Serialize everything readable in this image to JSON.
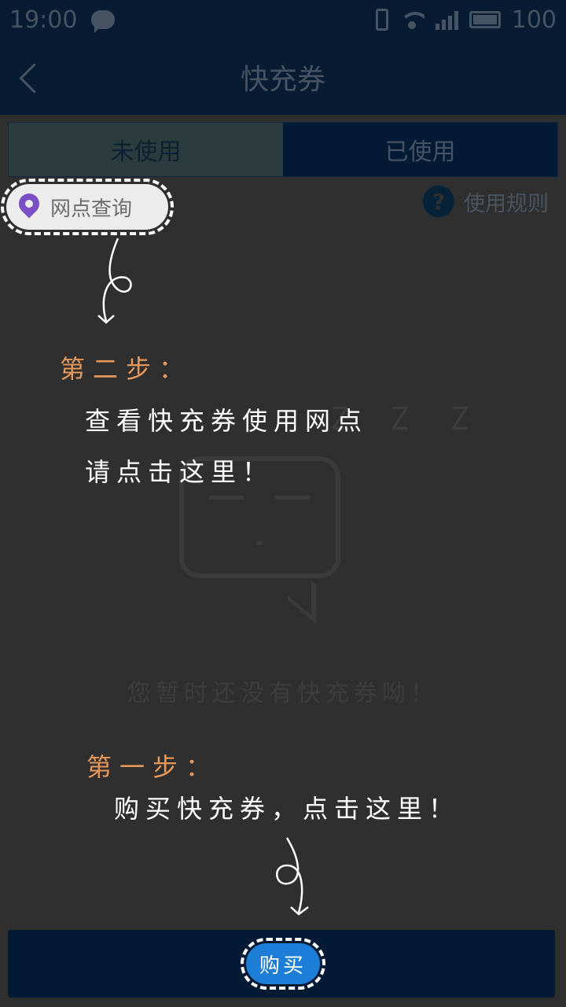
{
  "status_bar": {
    "time": "19:00",
    "battery": "100",
    "network_type": "4G",
    "icons": [
      "wechat-icon",
      "vibrate-icon",
      "wifi-icon",
      "signal-icon",
      "battery-icon"
    ]
  },
  "header": {
    "title": "快充券",
    "back_icon": "chevron-left-icon"
  },
  "tabs": [
    {
      "label": "未使用",
      "selected": true
    },
    {
      "label": "已使用",
      "selected": false
    }
  ],
  "outlets_button": {
    "label": "网点查询",
    "icon": "location-pin-icon"
  },
  "rules_link": {
    "label": "使用规则",
    "icon": "question-icon"
  },
  "empty_state": {
    "zzz": "Z Z Z",
    "message": "您暂时还没有快充券呦！"
  },
  "guide": {
    "step2": {
      "title": "第二步：",
      "line1": "查看快充券使用网点",
      "line2": "请点击这里！"
    },
    "step1": {
      "title": "第一步：",
      "line1": "购买快充券，点击这里！"
    }
  },
  "buy_button": {
    "label": "购买"
  },
  "colors": {
    "header_bg": "#071c33",
    "overlay_bg": "#2f2f2f",
    "step_title": "#e6985a",
    "guide_text": "#ffffff",
    "buy_button": "#1c7ed6",
    "pin_icon": "#7a4fc8"
  }
}
